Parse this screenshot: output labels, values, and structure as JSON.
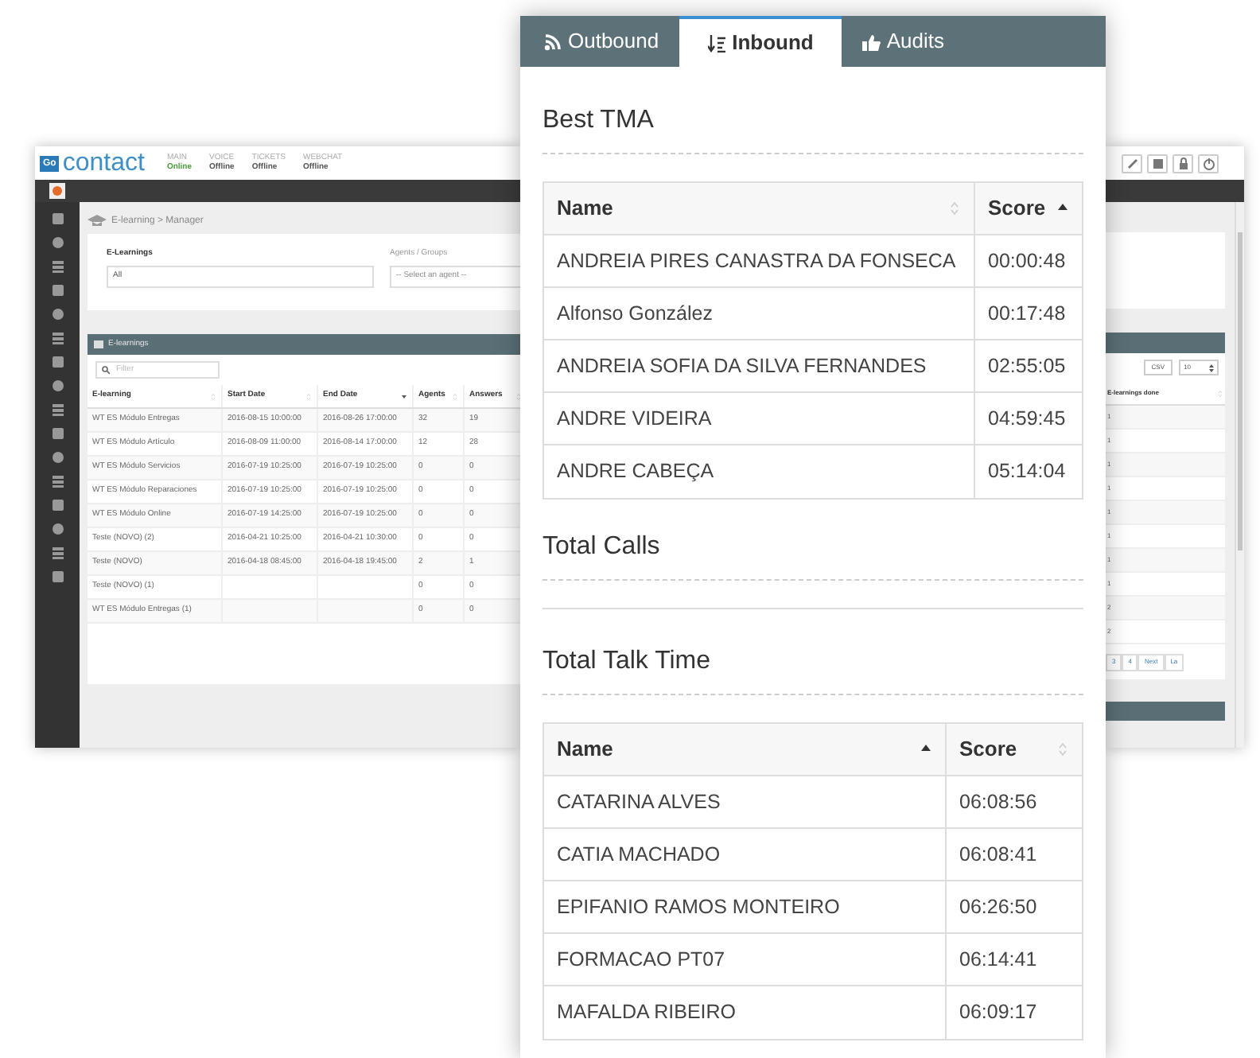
{
  "background_app": {
    "logo": {
      "badge": "Go",
      "name": "contact"
    },
    "channels": [
      {
        "label": "MAIN",
        "status": "Online",
        "online": true
      },
      {
        "label": "VOICE",
        "status": "Offline",
        "online": false
      },
      {
        "label": "TICKETS",
        "status": "Offline",
        "online": false
      },
      {
        "label": "WEBCHAT",
        "status": "Offline",
        "online": false
      }
    ],
    "breadcrumb": "E-learning > Manager",
    "filters": [
      {
        "label": "E-Learnings",
        "value": "All"
      },
      {
        "label": "Agents / Groups",
        "placeholder": "-- Select an agent --"
      }
    ],
    "panel_title": "E-learnings",
    "filter_placeholder": "Filter",
    "table": {
      "columns": [
        {
          "label": "E-learning",
          "sorted": false
        },
        {
          "label": "Start Date",
          "sorted": false
        },
        {
          "label": "End Date",
          "sorted": true,
          "ascending": false
        },
        {
          "label": "Agents",
          "sorted": false
        },
        {
          "label": "Answers",
          "sorted": false
        }
      ],
      "rows": [
        [
          "WT ES Módulo Entregas",
          "2016-08-15 10:00:00",
          "2016-08-26 17:00:00",
          "32",
          "19"
        ],
        [
          "WT ES Módulo Artículo",
          "2016-08-09 11:00:00",
          "2016-08-14 17:00:00",
          "12",
          "28"
        ],
        [
          "WT ES Módulo Servicios",
          "2016-07-19 10:25:00",
          "2016-07-19 10:25:00",
          "0",
          "0"
        ],
        [
          "WT ES Módulo Reparaciones",
          "2016-07-19 10:25:00",
          "2016-07-19 10:25:00",
          "0",
          "0"
        ],
        [
          "WT ES Módulo Online",
          "2016-07-19 14:25:00",
          "2016-07-19 10:25:00",
          "0",
          "0"
        ],
        [
          "Teste (NOVO) (2)",
          "2016-04-21 10:25:00",
          "2016-04-21 10:30:00",
          "0",
          "0"
        ],
        [
          "Teste (NOVO)",
          "2016-04-18 08:45:00",
          "2016-04-18 19:45:00",
          "2",
          "1"
        ],
        [
          "Teste (NOVO) (1)",
          "",
          "",
          "0",
          "0"
        ],
        [
          "WT ES Módulo Entregas (1)",
          "",
          "",
          "0",
          "0"
        ]
      ]
    },
    "right_table": {
      "export_button": "CSV",
      "page_size": "10",
      "column": "E-learnings done",
      "rows": [
        "1",
        "1",
        "1",
        "1",
        "1",
        "1",
        "1",
        "1",
        "2",
        "2"
      ],
      "pagination": [
        "3",
        "4",
        "Next",
        "La"
      ]
    }
  },
  "panel": {
    "tabs": [
      {
        "label": "Outbound",
        "selected": false
      },
      {
        "label": "Inbound",
        "selected": true
      },
      {
        "label": "Audits",
        "selected": false
      }
    ],
    "sections": [
      {
        "title": "Best TMA",
        "table": {
          "columns": [
            {
              "label": "Name",
              "sorted": false
            },
            {
              "label": "Score",
              "sorted": true,
              "ascending": true
            }
          ],
          "rows": [
            [
              "ANDREIA PIRES CANASTRA DA FONSECA",
              "00:00:48"
            ],
            [
              "Alfonso González",
              "00:17:48"
            ],
            [
              "ANDREIA SOFIA DA SILVA FERNANDES",
              "02:55:05"
            ],
            [
              "ANDRE VIDEIRA",
              "04:59:45"
            ],
            [
              "ANDRE CABEÇA",
              "05:14:04"
            ]
          ]
        }
      },
      {
        "title": "Total Calls"
      },
      {
        "title": "Total Talk Time",
        "table": {
          "columns": [
            {
              "label": "Name",
              "sorted": true,
              "ascending": true
            },
            {
              "label": "Score",
              "sorted": false
            }
          ],
          "rows": [
            [
              "CATARINA ALVES",
              "06:08:56"
            ],
            [
              "CATIA MACHADO",
              "06:08:41"
            ],
            [
              "EPIFANIO RAMOS MONTEIRO",
              "06:26:50"
            ],
            [
              "FORMACAO PT07",
              "06:14:41"
            ],
            [
              "MAFALDA RIBEIRO",
              "06:09:17"
            ]
          ]
        }
      }
    ]
  }
}
